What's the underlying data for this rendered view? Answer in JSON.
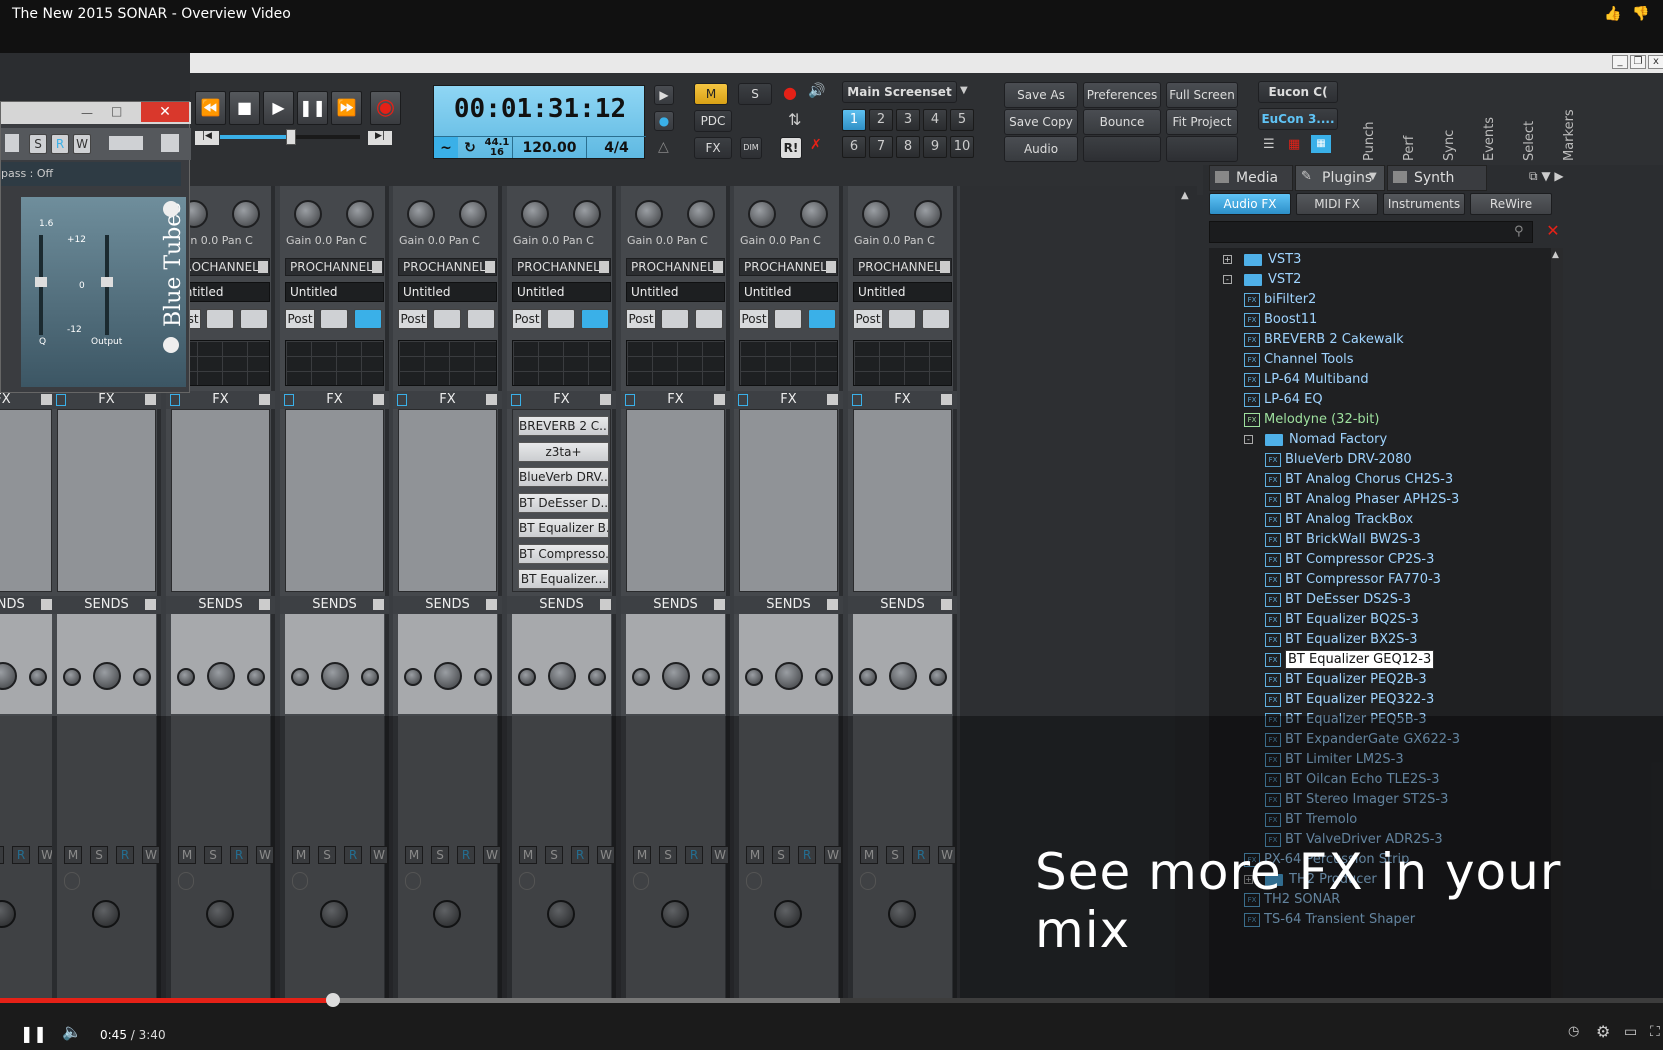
{
  "video": {
    "title": "The New 2015 SONAR - Overview Video",
    "current_time": "0:45",
    "duration": "3:40",
    "progress": 0.2,
    "overlay_text": "See more FX in your mix"
  },
  "toolbar": {
    "time": "00:01:31:12",
    "sample_rate": "44.1",
    "bit_depth": "16",
    "tempo": "120.00",
    "meter": "4/4",
    "m": "M",
    "s": "S",
    "pdc": "PDC",
    "fx": "FX",
    "dim": "DIM",
    "rl": "R!",
    "screenset_label": "Main Screenset",
    "screensets": [
      "1",
      "2",
      "3",
      "4",
      "5",
      "6",
      "7",
      "8",
      "9",
      "10"
    ],
    "save_as": "Save As",
    "preferences": "Preferences",
    "full_screen": "Full Screen",
    "save_copy": "Save Copy",
    "bounce": "Bounce",
    "fit_project": "Fit Project",
    "audio": "Audio",
    "eucon1": "Eucon C(",
    "eucon2": "EuCon 3....",
    "vtabs": [
      "Punch",
      "Perf",
      "Sync",
      "Events",
      "Select",
      "Markers"
    ]
  },
  "floatwin": {
    "bypass": "pass : Off",
    "s": "S",
    "r": "R",
    "w": "W",
    "scale_top": "+12",
    "scale_mid": "0",
    "scale_bot": "-12",
    "output": "Output",
    "plugin": "Blue Tubes",
    "val": "1.6",
    "q": "Q"
  },
  "mixer": {
    "gain_label": "Gain",
    "gain_val": "0.0",
    "pan_label": "Pan",
    "pan_val": "C",
    "prochannel": "PROCHANNEL",
    "untitled": "Untitled",
    "post": "Post",
    "fx_label": "FX",
    "sends_label": "SENDS",
    "msrw": [
      "M",
      "S",
      "R",
      "W"
    ],
    "fx_chain": [
      "BREVERB 2 C...",
      "z3ta+",
      "BlueVerb DRV...",
      "BT DeEsser D...",
      "BT Equalizer B...",
      "BT Compresso...",
      "BT Equalizer..."
    ]
  },
  "browser": {
    "tabs": [
      "Media",
      "Plugins",
      "Synth"
    ],
    "filters": [
      "Audio FX",
      "MIDI FX",
      "Instruments",
      "ReWire"
    ],
    "tree": [
      {
        "label": "VST3",
        "kind": "folder",
        "level": 0,
        "exp": "+"
      },
      {
        "label": "VST2",
        "kind": "folder",
        "level": 0,
        "exp": "-"
      },
      {
        "label": "biFilter2",
        "kind": "fx",
        "level": 1
      },
      {
        "label": "Boost11",
        "kind": "fx",
        "level": 1
      },
      {
        "label": "BREVERB 2 Cakewalk",
        "kind": "fx",
        "level": 1
      },
      {
        "label": "Channel Tools",
        "kind": "fx",
        "level": 1
      },
      {
        "label": "LP-64 Multiband",
        "kind": "fx",
        "level": 1
      },
      {
        "label": "LP-64 EQ",
        "kind": "fx",
        "level": 1
      },
      {
        "label": "Melodyne (32-bit)",
        "kind": "fx",
        "level": 1,
        "green": true
      },
      {
        "label": "Nomad Factory",
        "kind": "folder",
        "level": 1,
        "exp": "-"
      },
      {
        "label": "BlueVerb DRV-2080",
        "kind": "fx",
        "level": 2
      },
      {
        "label": "BT Analog Chorus CH2S-3",
        "kind": "fx",
        "level": 2
      },
      {
        "label": "BT Analog Phaser APH2S-3",
        "kind": "fx",
        "level": 2
      },
      {
        "label": "BT Analog TrackBox",
        "kind": "fx",
        "level": 2
      },
      {
        "label": "BT BrickWall BW2S-3",
        "kind": "fx",
        "level": 2
      },
      {
        "label": "BT Compressor CP2S-3",
        "kind": "fx",
        "level": 2
      },
      {
        "label": "BT Compressor FA770-3",
        "kind": "fx",
        "level": 2
      },
      {
        "label": "BT DeEsser DS2S-3",
        "kind": "fx",
        "level": 2
      },
      {
        "label": "BT Equalizer BQ2S-3",
        "kind": "fx",
        "level": 2
      },
      {
        "label": "BT Equalizer BX2S-3",
        "kind": "fx",
        "level": 2
      },
      {
        "label": "BT Equalizer GEQ12-3",
        "kind": "fx",
        "level": 2,
        "selected": true
      },
      {
        "label": "BT Equalizer PEQ2B-3",
        "kind": "fx",
        "level": 2
      },
      {
        "label": "BT Equalizer PEQ322-3",
        "kind": "fx",
        "level": 2
      },
      {
        "label": "BT Equalizer PEQ5B-3",
        "kind": "fx",
        "level": 2
      },
      {
        "label": "BT ExpanderGate GX622-3",
        "kind": "fx",
        "level": 2
      },
      {
        "label": "BT Limiter LM2S-3",
        "kind": "fx",
        "level": 2
      },
      {
        "label": "BT Oilcan Echo TLE2S-3",
        "kind": "fx",
        "level": 2
      },
      {
        "label": "BT Stereo Imager ST2S-3",
        "kind": "fx",
        "level": 2
      },
      {
        "label": "BT Tremolo",
        "kind": "fx",
        "level": 2
      },
      {
        "label": "BT ValveDriver ADR2S-3",
        "kind": "fx",
        "level": 2
      },
      {
        "label": "PX-64 Percussion Strip",
        "kind": "fx",
        "level": 1
      },
      {
        "label": "TH2 Producer",
        "kind": "folder",
        "level": 1,
        "exp": "+"
      },
      {
        "label": "TH2 SONAR",
        "kind": "fx",
        "level": 1
      },
      {
        "label": "TS-64 Transient Shaper",
        "kind": "fx",
        "level": 1
      }
    ]
  },
  "colors": {
    "accent": "#3ab0e8",
    "record": "#e52117",
    "clock": "#7ccbef"
  }
}
